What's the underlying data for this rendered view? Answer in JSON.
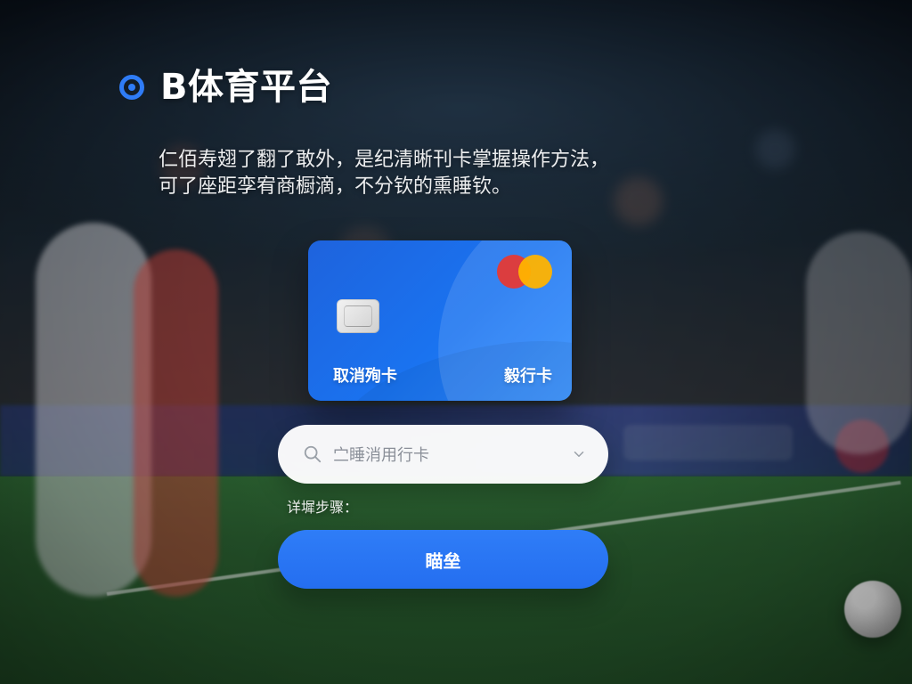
{
  "brand": {
    "title": "B体育平台",
    "accent_color": "#2f7cf6"
  },
  "description": {
    "line1": "仁佰寿翅了翻了敢外，是纪清晰刊卡掌握操作方法，",
    "line2": "可了座距孪宥商橱滴，不分钦的熏睡钦。"
  },
  "card": {
    "left_label": "取消殉卡",
    "right_label": "毅行卡",
    "card_color": "#1a73f0",
    "chip_icon": "chip-icon",
    "brand_mark_icon": "mastercard-icon"
  },
  "select": {
    "placeholder": "㝉睡消用行卡",
    "search_icon": "search-icon",
    "chevron_icon": "chevron-down-icon"
  },
  "steps": {
    "label": "详墀步骤："
  },
  "primary_button": {
    "label": "瞄垒",
    "color": "#2f7df7"
  }
}
